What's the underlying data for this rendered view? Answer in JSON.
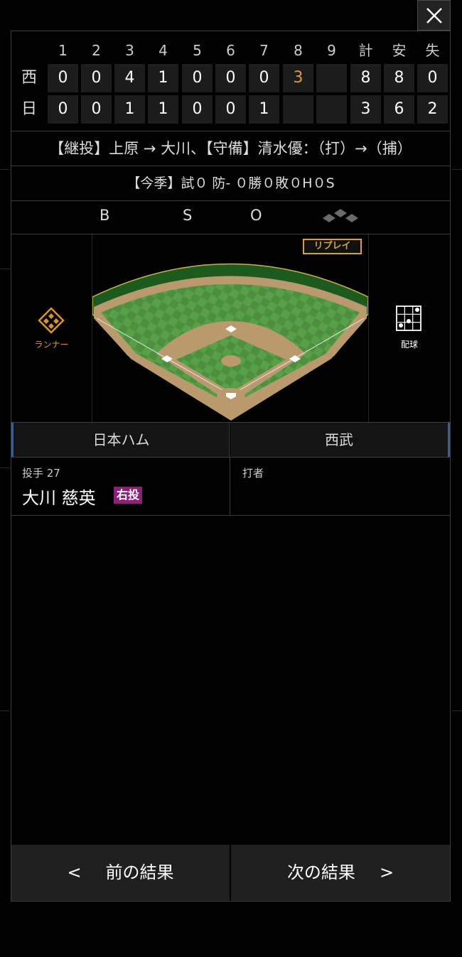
{
  "scoreboard": {
    "innings": [
      "1",
      "2",
      "3",
      "4",
      "5",
      "6",
      "7",
      "8",
      "9"
    ],
    "totals_headers": [
      "計",
      "安",
      "失"
    ],
    "teams": [
      {
        "abbr": "西",
        "scores": [
          "0",
          "0",
          "4",
          "1",
          "0",
          "0",
          "0",
          "3",
          ""
        ],
        "totals": [
          "8",
          "8",
          "0"
        ],
        "highlight_index": 7
      },
      {
        "abbr": "日",
        "scores": [
          "0",
          "0",
          "1",
          "1",
          "0",
          "0",
          "1",
          "",
          ""
        ],
        "totals": [
          "3",
          "6",
          "2"
        ],
        "highlight_index": -1
      }
    ]
  },
  "change_text": "【継投】上原 → 大川、【守備】清水優：（打）→（捕）",
  "season_text": "【今季】試０ 防- ０勝０敗０H０S",
  "count": {
    "ball_label": "B",
    "strike_label": "S",
    "out_label": "O"
  },
  "replay_label": "リプレイ",
  "runner_label": "ランナー",
  "pitch_label": "配球",
  "tabs": {
    "left": "日本ハム",
    "right": "西武"
  },
  "pitcher": {
    "role_label": "投手 27",
    "name": "大川 慈英",
    "hand_badge": "右投"
  },
  "batter": {
    "role_label": "打者"
  },
  "nav": {
    "prev": "前の結果",
    "next": "次の結果",
    "prev_arrow": "<",
    "next_arrow": ">"
  },
  "colors": {
    "accent_orange": "#e79a3a",
    "badge_purple": "#8b1f7a",
    "replay_gold": "#d4a23a"
  }
}
